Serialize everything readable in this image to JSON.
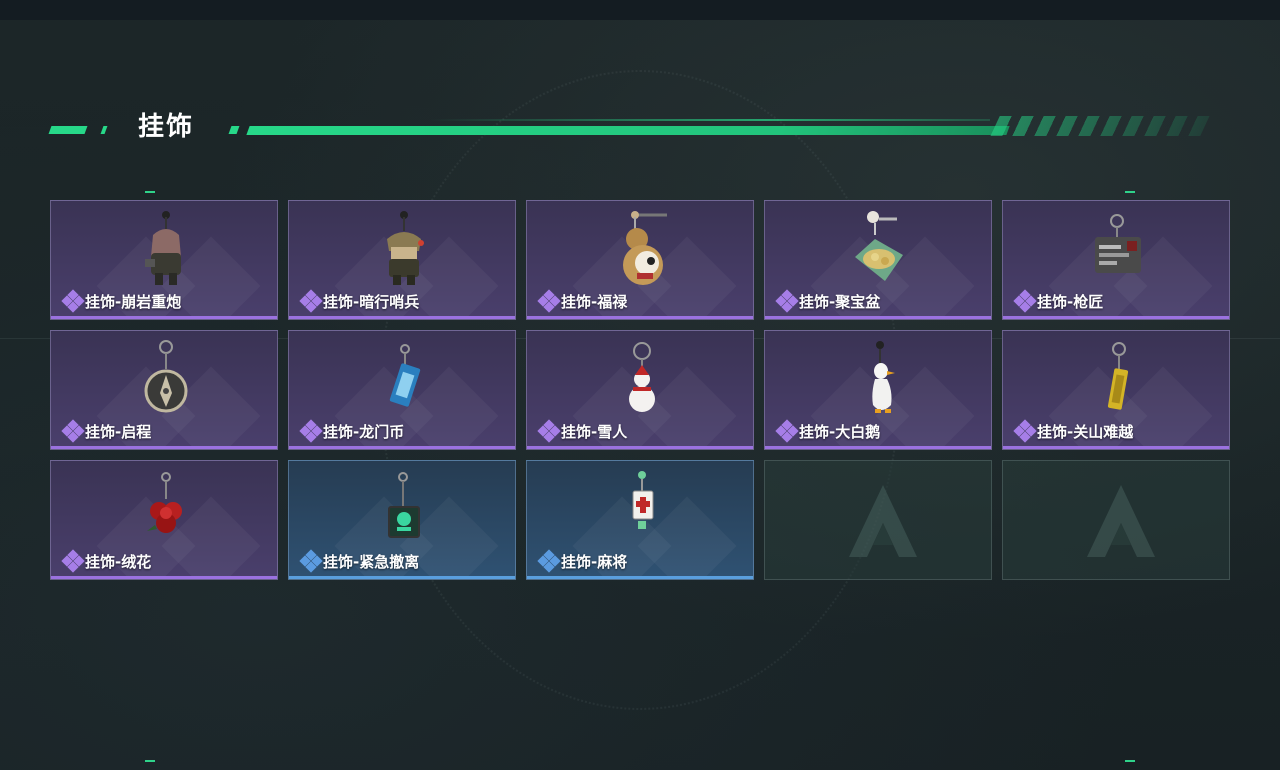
{
  "section": {
    "title": "挂饰"
  },
  "items": [
    {
      "name": "挂饰-崩岩重炮",
      "rarity": "purple",
      "icon": "rock-cannon-charm-icon"
    },
    {
      "name": "挂饰-暗行哨兵",
      "rarity": "purple",
      "icon": "sentinel-charm-icon"
    },
    {
      "name": "挂饰-福禄",
      "rarity": "purple",
      "icon": "gourd-charm-icon"
    },
    {
      "name": "挂饰-聚宝盆",
      "rarity": "purple",
      "icon": "treasure-bowl-charm-icon"
    },
    {
      "name": "挂饰-枪匠",
      "rarity": "purple",
      "icon": "gunsmith-charm-icon"
    },
    {
      "name": "挂饰-启程",
      "rarity": "purple",
      "icon": "compass-charm-icon"
    },
    {
      "name": "挂饰-龙门币",
      "rarity": "purple",
      "icon": "coin-charm-icon"
    },
    {
      "name": "挂饰-雪人",
      "rarity": "purple",
      "icon": "snowman-charm-icon"
    },
    {
      "name": "挂饰-大白鹅",
      "rarity": "purple",
      "icon": "goose-charm-icon"
    },
    {
      "name": "挂饰-关山难越",
      "rarity": "purple",
      "icon": "gold-bar-charm-icon"
    },
    {
      "name": "挂饰-绒花",
      "rarity": "purple",
      "icon": "velvet-flower-charm-icon"
    },
    {
      "name": "挂饰-紧急撤离",
      "rarity": "blue",
      "icon": "evacuation-charm-icon"
    },
    {
      "name": "挂饰-麻将",
      "rarity": "blue",
      "icon": "mahjong-charm-icon"
    }
  ],
  "empty_slots": 2,
  "colors": {
    "accent": "#27d889",
    "rarity_purple": "#9b72e0",
    "rarity_blue": "#5a9fde"
  }
}
